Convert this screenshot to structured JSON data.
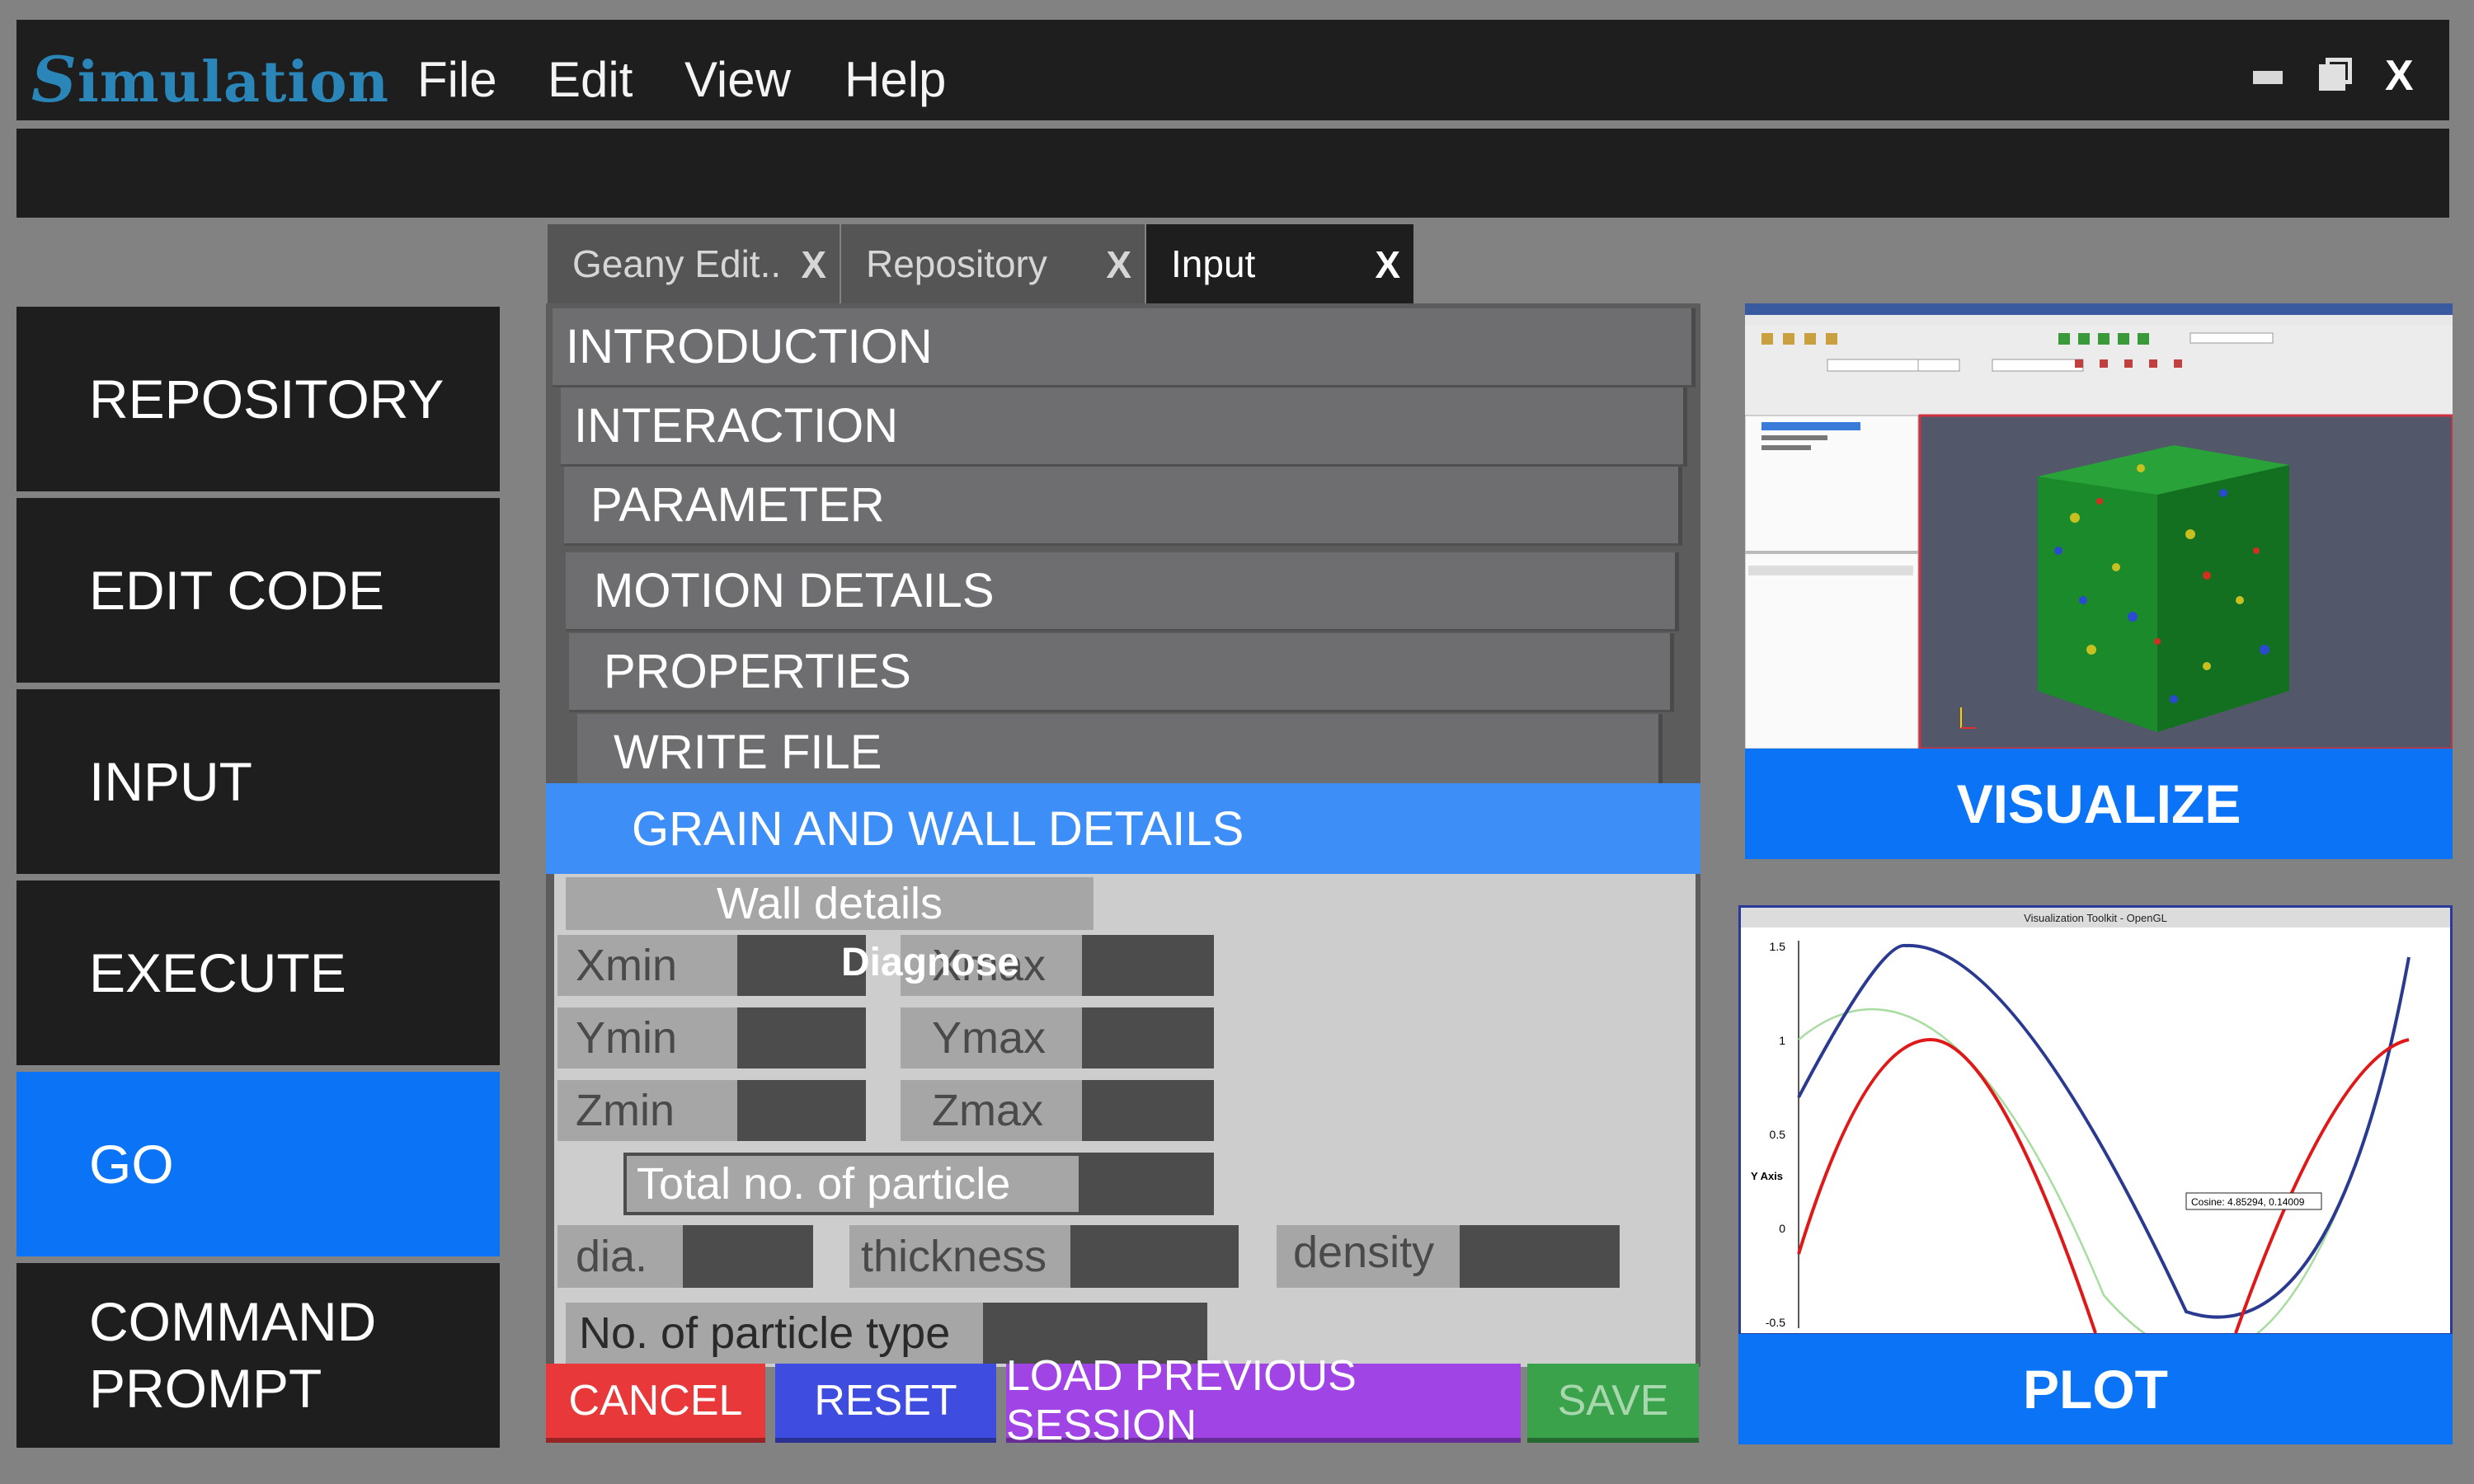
{
  "app": {
    "logo_first": "S",
    "logo_rest": "imulation"
  },
  "menu": {
    "file": "File",
    "edit": "Edit",
    "view": "View",
    "help": "Help"
  },
  "window": {
    "close": "X"
  },
  "sidebar": {
    "items": [
      {
        "label": "REPOSITORY"
      },
      {
        "label": "EDIT CODE"
      },
      {
        "label": "INPUT"
      },
      {
        "label": "EXECUTE"
      },
      {
        "label": "GO"
      },
      {
        "label": "COMMAND\nPROMPT"
      }
    ]
  },
  "tabs": [
    {
      "label": "Geany Edit..",
      "close": "X"
    },
    {
      "label": "Repository",
      "close": "X"
    },
    {
      "label": "Input",
      "close": "X"
    }
  ],
  "sections": [
    "INTRODUCTION",
    "INTERACTION",
    "PARAMETER",
    "MOTION DETAILS",
    "PROPERTIES",
    "WRITE FILE"
  ],
  "active_section": "GRAIN AND WALL DETAILS",
  "wall": {
    "header": "Wall details",
    "diagnose": "Diagnose",
    "xmin": "Xmin",
    "xmax": "Xmax",
    "ymin": "Ymin",
    "ymax": "Ymax",
    "zmin": "Zmin",
    "zmax": "Zmax",
    "total_particle": "Total no. of particle",
    "dia": "dia.",
    "thickness": "thickness",
    "density": "density",
    "particle_type": "No. of particle type"
  },
  "buttons": {
    "cancel": "CANCEL",
    "reset": "RESET",
    "load": "LOAD PREVIOUS SESSION",
    "save": "SAVE"
  },
  "colors": {
    "accent_blue": "#0b74f6",
    "section_active": "#3d8ef7",
    "cancel": "#e8383a",
    "reset": "#3f4ce0",
    "load": "#a044e6",
    "save": "#3aa24a"
  },
  "visualize": {
    "label": "VISUALIZE"
  },
  "plot": {
    "label": "PLOT",
    "window_title": "Visualization Toolkit - OpenGL",
    "tooltip": "Cosine: 4.85294, 0.14009",
    "y_axis_label": "Y Axis",
    "y_ticks": [
      "1.5",
      "1",
      "0.5",
      "0",
      "-0.5"
    ]
  }
}
